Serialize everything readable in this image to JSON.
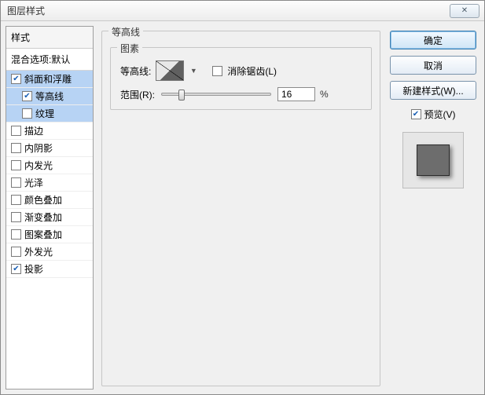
{
  "title": "图层样式",
  "close_glyph": "✕",
  "left": {
    "header": "样式",
    "blend": "混合选项:默认",
    "items": [
      {
        "label": "斜面和浮雕",
        "checked": true,
        "selected": true,
        "child": false
      },
      {
        "label": "等高线",
        "checked": true,
        "selected": true,
        "child": true
      },
      {
        "label": "纹理",
        "checked": false,
        "selected": true,
        "child": true
      },
      {
        "label": "描边",
        "checked": false,
        "selected": false,
        "child": false
      },
      {
        "label": "内阴影",
        "checked": false,
        "selected": false,
        "child": false
      },
      {
        "label": "内发光",
        "checked": false,
        "selected": false,
        "child": false
      },
      {
        "label": "光泽",
        "checked": false,
        "selected": false,
        "child": false
      },
      {
        "label": "颜色叠加",
        "checked": false,
        "selected": false,
        "child": false
      },
      {
        "label": "渐变叠加",
        "checked": false,
        "selected": false,
        "child": false
      },
      {
        "label": "图案叠加",
        "checked": false,
        "selected": false,
        "child": false
      },
      {
        "label": "外发光",
        "checked": false,
        "selected": false,
        "child": false
      },
      {
        "label": "投影",
        "checked": true,
        "selected": false,
        "child": false
      }
    ]
  },
  "mid": {
    "outer_legend": "等高线",
    "inner_legend": "图素",
    "contour_label": "等高线:",
    "antialias_label": "消除锯齿(L)",
    "range_label": "范围(R):",
    "range_value": "16",
    "range_pct": "%",
    "slider_pos_pct": 16
  },
  "right": {
    "ok": "确定",
    "cancel": "取消",
    "new_style": "新建样式(W)...",
    "preview_label": "预览(V)",
    "preview_checked": true
  }
}
